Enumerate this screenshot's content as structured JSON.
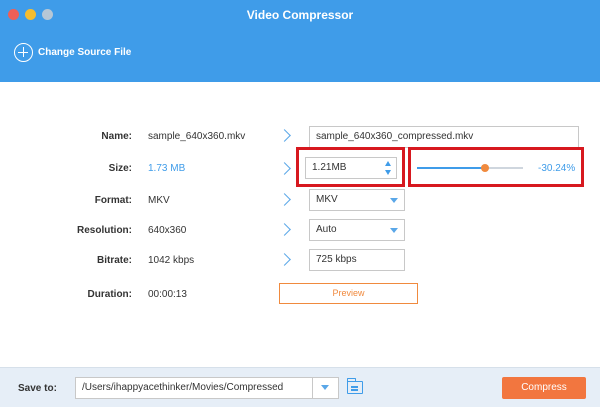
{
  "window": {
    "title": "Video Compressor"
  },
  "toolbar": {
    "change_source_label": "Change Source File"
  },
  "form": {
    "name": {
      "label": "Name:",
      "source": "sample_640x360.mkv",
      "output": "sample_640x360_compressed.mkv"
    },
    "size": {
      "label": "Size:",
      "source": "1.73 MB",
      "output": "1.21MB",
      "percent_text": "-30.24%",
      "slider_fraction": 0.64
    },
    "format": {
      "label": "Format:",
      "source": "MKV",
      "output": "MKV"
    },
    "resolution": {
      "label": "Resolution:",
      "source": "640x360",
      "output": "Auto"
    },
    "bitrate": {
      "label": "Bitrate:",
      "source": "1042 kbps",
      "output": "725 kbps"
    },
    "duration": {
      "label": "Duration:",
      "source": "00:00:13"
    }
  },
  "buttons": {
    "preview": "Preview",
    "compress": "Compress"
  },
  "bottom": {
    "save_to_label": "Save to:",
    "save_path": "/Users/ihappyacethinker/Movies/Compressed"
  },
  "colors": {
    "accent": "#3f9ce9",
    "orange": "#f2763f",
    "highlight": "#d7181f"
  },
  "icons": {
    "add": "plus-circle-icon",
    "folder": "folder-icon",
    "arrow": "chevron-right-icon"
  }
}
